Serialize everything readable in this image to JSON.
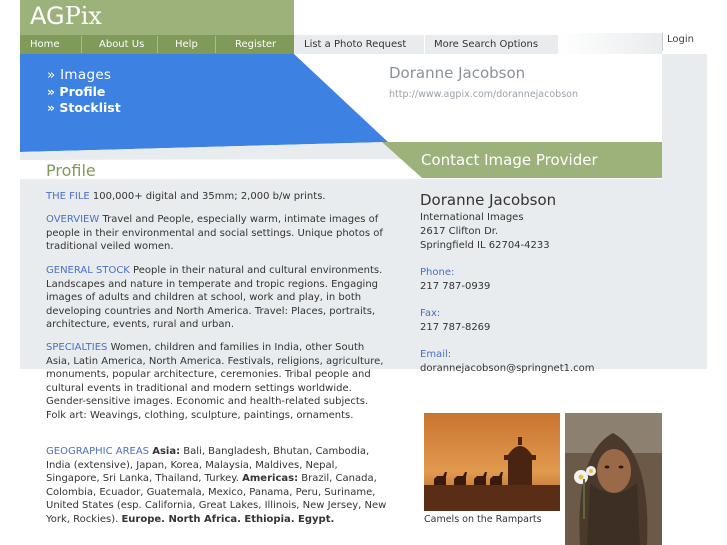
{
  "logo": {
    "ag": "AG",
    "pix": "Pix"
  },
  "nav": {
    "home": "Home",
    "about": "About Us",
    "help": "Help",
    "register": "Register",
    "photo_request": "List a Photo Request",
    "search_options": "More Search Options",
    "login": "Login"
  },
  "sidebar": {
    "items": [
      {
        "label": "» Images"
      },
      {
        "label": "» Profile"
      },
      {
        "label": "» Stocklist"
      }
    ]
  },
  "header": {
    "provider_name": "Doranne Jacobson",
    "provider_url": "http://www.agpix.com/dorannejacobson"
  },
  "contact_banner": "Contact Image Provider",
  "profile": {
    "title": "Profile",
    "the_file": {
      "label": "THE FILE",
      "text": " 100,000+ digital and 35mm; 2,000 b/w prints."
    },
    "overview": {
      "label": "OVERVIEW",
      "text": " Travel and People, especially warm, intimate images of people in their environmental and social settings. Unique photos of traditional veiled women."
    },
    "general_stock": {
      "label": "GENERAL STOCK",
      "text": " People in their natural and cultural environments. Landscapes and nature in temperate and tropic regions. Engaging images of adults and children at school, work and play, in both developing countries and North America. Travel: Places, portraits, architecture, events, rural and urban."
    },
    "specialties": {
      "label": "SPECIALTIES",
      "text": " Women, children and families in India, other South Asia, Latin America, North America. Festivals, religions, agriculture, monuments, popular architecture, ceremonies. Tribal people and cultural events in traditional and modern settings worldwide. Gender-sensitive images. Economic and health-related subjects. Folk art: Weavings, clothing, sculpture, paintings, ornaments."
    },
    "geographic": {
      "label": "GEOGRAPHIC AREAS",
      "asia_label": "Asia:",
      "asia_text": " Bali, Bangladesh, Bhutan, Cambodia, India (extensive), Japan, Korea, Malaysia, Maldives, Nepal, Singapore, Sri Lanka, Thailand, Turkey. ",
      "americas_label": "Americas:",
      "americas_text": " Brazil, Canada, Colombia, Ecuador, Guatemala, Mexico, Panama, Peru, Suriname, United States (esp. California, Great Lakes, Illinois, New Jersey, New York, Rockies). ",
      "europe": "Europe. North Africa. Ethiopia. Egypt."
    }
  },
  "contact": {
    "name": "Doranne Jacobson",
    "company": "International Images",
    "street": "2617 Clifton Dr.",
    "city": "Springfield IL 62704-4233",
    "phone_label": "Phone:",
    "phone": "217 787-0939",
    "fax_label": "Fax:",
    "fax": "217 787-8269",
    "email_label": "Email:",
    "email": "dorannejacobson@springnet1.com"
  },
  "gallery": {
    "caption1": "Camels on the Ramparts"
  },
  "colors": {
    "green": "#7f9a59",
    "blue": "#3d82e3",
    "sage": "#9cb27a",
    "link_blue": "#4a6fc6"
  }
}
